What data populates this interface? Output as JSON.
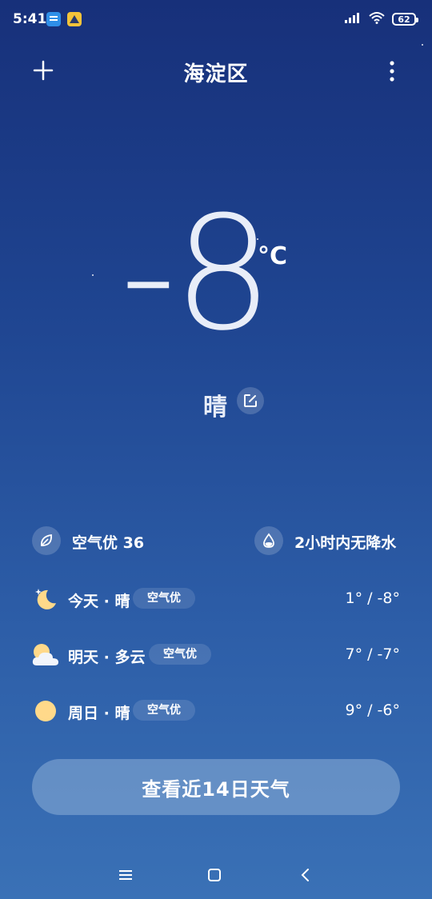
{
  "status_bar": {
    "time": "5:41",
    "battery": "62"
  },
  "header": {
    "city": "海淀区"
  },
  "current": {
    "temperature": "-8",
    "unit": "°C",
    "condition": "晴"
  },
  "info": {
    "air_quality": "空气优 36",
    "precipitation": "2小时内无降水"
  },
  "forecast": [
    {
      "label": "今天 · 晴",
      "air": "空气优",
      "temps": "1° / -8°",
      "icon": "moon-icon"
    },
    {
      "label": "明天 · 多云",
      "air": "空气优",
      "temps": "7° / -7°",
      "icon": "cloudy-icon"
    },
    {
      "label": "周日 · 晴",
      "air": "空气优",
      "temps": "9° / -6°",
      "icon": "sun-icon"
    }
  ],
  "forecast_button": "查看近14日天气",
  "colors": {
    "background_top": "#17307a",
    "background_bottom": "#3a71b6",
    "sun": "#ffd98a"
  }
}
